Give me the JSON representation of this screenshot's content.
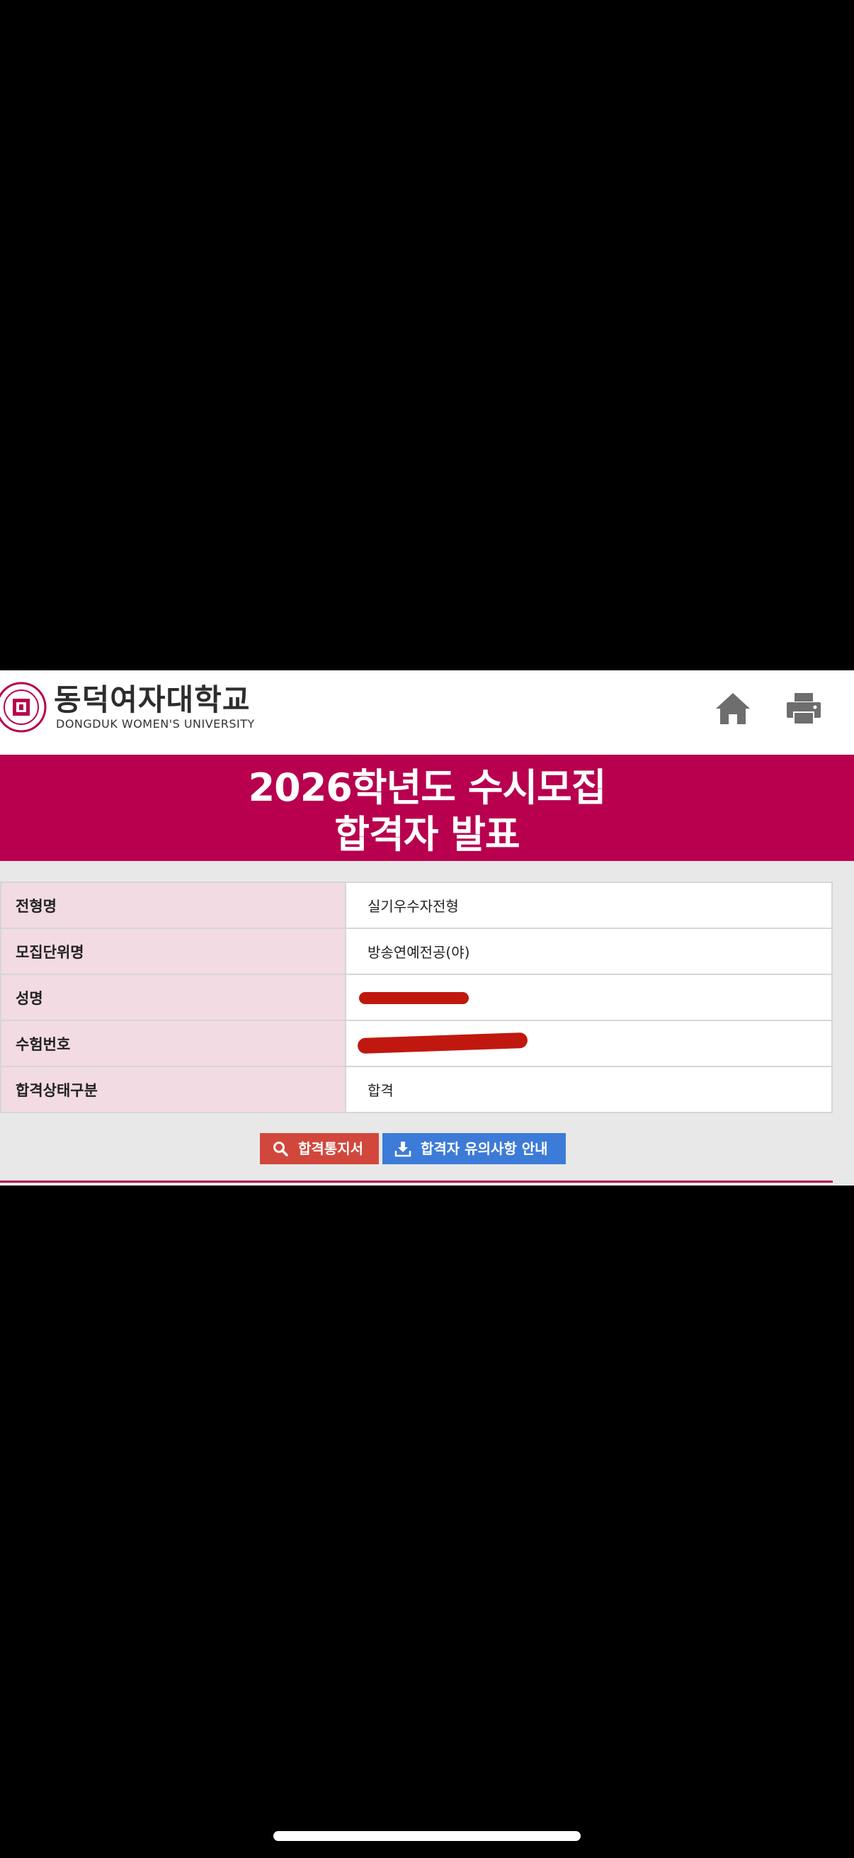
{
  "header": {
    "logo_korean": "동덕여자대학교",
    "logo_english": "DONGDUK WOMEN'S UNIVERSITY",
    "home_icon": "home-icon",
    "print_icon": "printer-icon"
  },
  "banner": {
    "line1": "2026학년도 수시모집",
    "line2": "합격자 발표",
    "color": "#b8004e"
  },
  "result": {
    "rows": [
      {
        "label": "전형명",
        "value": "실기우수자전형"
      },
      {
        "label": "모집단위명",
        "value": "방송연예전공(야)"
      },
      {
        "label": "성명",
        "value": ""
      },
      {
        "label": "수험번호",
        "value": ""
      },
      {
        "label": "합격상태구분",
        "value": "합격"
      }
    ]
  },
  "buttons": {
    "notice_label": "합격통지서",
    "notice_icon": "search-icon",
    "notice_color": "#d2473c",
    "guide_label": "합격자 유의사항 안내",
    "guide_icon": "download-icon",
    "guide_color": "#3d7bd8"
  }
}
